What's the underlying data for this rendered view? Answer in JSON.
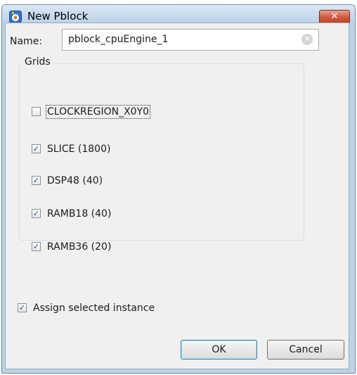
{
  "window": {
    "title": "New Pblock",
    "close_label": "✕"
  },
  "name_field": {
    "label": "Name:",
    "value": "pblock_cpuEngine_1",
    "clear_icon": "clear-icon"
  },
  "grids": {
    "legend": "Grids",
    "items": [
      {
        "label": "CLOCKREGION_X0Y0",
        "checked": false
      },
      {
        "label": "SLICE (1800)",
        "checked": true
      },
      {
        "label": "DSP48 (40)",
        "checked": true
      },
      {
        "label": "RAMB18 (40)",
        "checked": true
      },
      {
        "label": "RAMB36 (20)",
        "checked": true
      }
    ]
  },
  "assign": {
    "label": "Assign selected instance",
    "checked": true
  },
  "buttons": {
    "ok": "OK",
    "cancel": "Cancel"
  },
  "colors": {
    "title_bar": "#c4d8ec",
    "close_button": "#d05a3e",
    "dialog_bg": "#f0f0f0",
    "check_mark": "#1f4f91"
  }
}
